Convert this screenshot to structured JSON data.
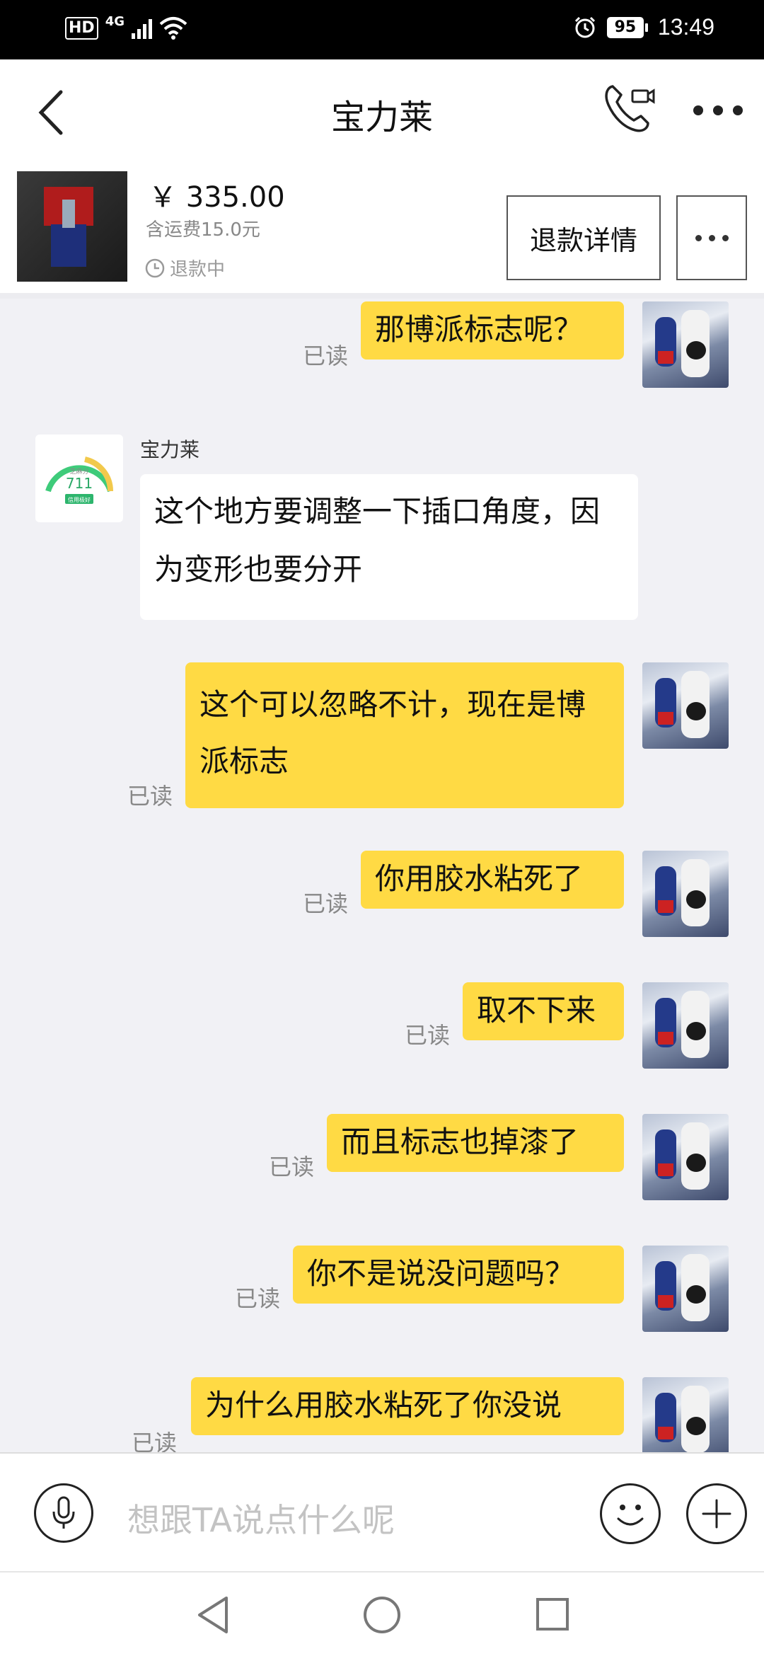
{
  "status_bar": {
    "hd": "HD",
    "network": "4G",
    "battery": "95",
    "time": "13:49"
  },
  "header": {
    "title": "宝力莱"
  },
  "product": {
    "price": "￥ 335.00",
    "shipping": "含运费15.0元",
    "status": "退款中",
    "refund_button": "退款详情"
  },
  "chat": {
    "read_label": "已读",
    "sender_name": "宝力莱",
    "credit_widget": {
      "label": "芝麻分",
      "score": "711",
      "badge": "信用极好"
    },
    "messages": [
      {
        "from": "me",
        "text": "那博派标志呢？"
      },
      {
        "from": "other",
        "text": "这个地方要调整一下插口角度，因为变形也要分开"
      },
      {
        "from": "me",
        "text": "这个可以忽略不计，现在是博派标志"
      },
      {
        "from": "me",
        "text": "你用胶水粘死了"
      },
      {
        "from": "me",
        "text": "取不下来"
      },
      {
        "from": "me",
        "text": "而且标志也掉漆了"
      },
      {
        "from": "me",
        "text": "你不是说没问题吗？"
      },
      {
        "from": "me",
        "text": "为什么用胶水粘死了你没说"
      }
    ]
  },
  "input": {
    "placeholder": "想跟TA说点什么呢"
  }
}
